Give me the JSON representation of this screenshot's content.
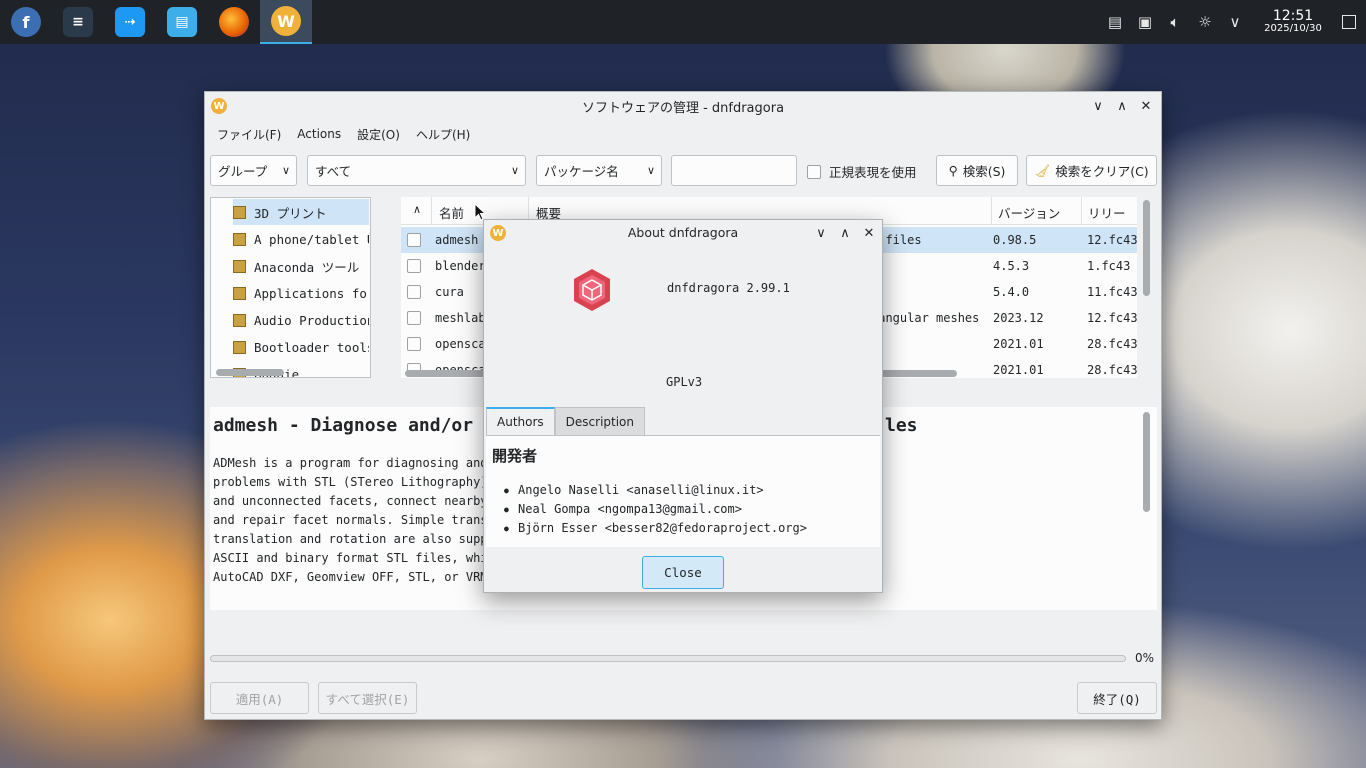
{
  "taskbar": {
    "launchers": [
      {
        "name": "fedora-icon",
        "glyph": "f",
        "bg": "#3c6eb4"
      },
      {
        "name": "system-settings-icon",
        "glyph": "≡",
        "bg": "#2b3a4a"
      },
      {
        "name": "software-center-icon",
        "glyph": "⇢",
        "bg": "#1d99f3"
      },
      {
        "name": "file-manager-icon",
        "glyph": "▤",
        "bg": "#3daee9"
      },
      {
        "name": "firefox-icon",
        "glyph": "◉",
        "bg": "#e66000"
      },
      {
        "name": "dnfdragora-icon",
        "glyph": "W",
        "bg": "#f0b13a"
      }
    ],
    "clock_time": "12:51",
    "clock_date": "2025/10/30"
  },
  "window": {
    "title": "ソフトウェアの管理 - dnfdragora",
    "menu": [
      "ファイル(F)",
      "Actions",
      "設定(O)",
      "ヘルプ(H)"
    ],
    "filters": {
      "group_combo": "グループ",
      "status_combo": "すべて",
      "field_combo": "パッケージ名",
      "search_value": "",
      "regex_label": "正規表現を使用",
      "search_button": "検索(S)",
      "clear_button": "検索をクリア(C)"
    },
    "groups": [
      "3D プリント",
      "A phone/tablet UX",
      "Anaconda ツール",
      "Applications for t",
      "Audio Production",
      "Bootloader tools f",
      "Budgie"
    ],
    "table": {
      "headers": {
        "name": "名前",
        "summary": "概要",
        "version": "バージョン",
        "release": "リリース"
      },
      "rows": [
        {
          "name": "admesh",
          "summary": "y files",
          "version": "0.98.5",
          "release": "12.fc43"
        },
        {
          "name": "blender",
          "summary": "",
          "version": "4.5.3",
          "release": "1.fc43"
        },
        {
          "name": "cura",
          "summary": "",
          "version": "5.4.0",
          "release": "11.fc43"
        },
        {
          "name": "meshlab",
          "summary": "iangular meshes",
          "version": "2023.12",
          "release": "12.fc43"
        },
        {
          "name": "openscad",
          "summary": "",
          "version": "2021.01",
          "release": "28.fc43"
        },
        {
          "name": "openscad",
          "summary": "",
          "version": "2021.01",
          "release": "28.fc43"
        }
      ]
    },
    "detail": {
      "heading_left": "admesh - Diagnose and/or re",
      "heading_right": "les",
      "lines": [
        "ADMesh is a program for diagnosing and/or",
        "problems with STL (STereo Lithography) dat",
        "and unconnected facets, connect nearby fac",
        "and repair facet normals. Simple transfor",
        "translation and rotation are also supporte",
        "ASCII and binary format STL files, while t",
        "AutoCAD DXF, Geomview OFF, STL, or VRML fo"
      ]
    },
    "progress_label": "0%",
    "buttons": {
      "apply": "適用(A)",
      "select_all": "すべて選択(E)",
      "quit": "終了(Q)"
    }
  },
  "about": {
    "title": "About dnfdragora",
    "app_version": "dnfdragora 2.99.1",
    "license": "GPLv3",
    "tabs": [
      "Authors",
      "Description"
    ],
    "developers_heading": "開発者",
    "authors": [
      "Angelo Naselli <anaselli@linux.it>",
      "Neal Gompa <ngompa13@gmail.com>",
      "Björn Esser <besser82@fedoraproject.org>"
    ],
    "close_button": "Close"
  },
  "colors": {
    "accent": "#3daee9",
    "selection": "#cfe4f6",
    "logo": "#e0455c"
  }
}
